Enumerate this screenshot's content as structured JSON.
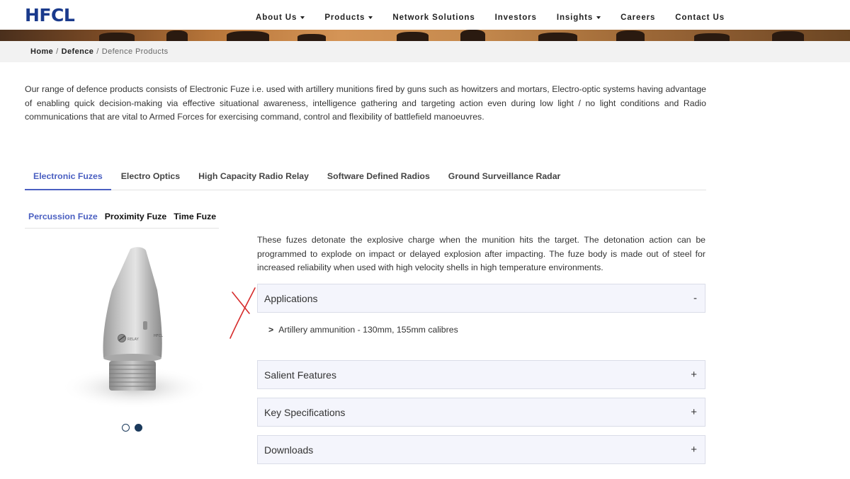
{
  "header": {
    "logo": "HFCL",
    "nav": [
      {
        "label": "About Us",
        "dropdown": true
      },
      {
        "label": "Products",
        "dropdown": true
      },
      {
        "label": "Network Solutions",
        "dropdown": false
      },
      {
        "label": "Investors",
        "dropdown": false
      },
      {
        "label": "Insights",
        "dropdown": true
      },
      {
        "label": "Careers",
        "dropdown": false
      },
      {
        "label": "Contact Us",
        "dropdown": false
      }
    ]
  },
  "breadcrumb": {
    "home": "Home",
    "sep": "/",
    "defence": "Defence",
    "current": "Defence Products"
  },
  "intro": "Our range of defence products consists of Electronic Fuze i.e. used with artillery munitions fired by guns such as howitzers and mortars, Electro-optic systems having advantage of enabling quick decision-making via effective situational awareness, intelligence gathering and targeting action even during low light / no light conditions and Radio communications that are vital to Armed Forces for exercising command, control and flexibility of battlefield manoeuvres.",
  "tabs": [
    "Electronic Fuzes",
    "Electro Optics",
    "High Capacity Radio Relay",
    "Software Defined Radios",
    "Ground Surveillance Radar"
  ],
  "subtabs": [
    "Percussion Fuze",
    "Proximity Fuze",
    "Time Fuze"
  ],
  "product": {
    "description": "These fuzes detonate the explosive charge when the munition hits the target. The detonation action can be programmed to explode on impact or delayed explosion after impacting. The fuze body is made out of steel for increased reliability when used with high velocity shells in high temperature environments.",
    "engraving_1": "RELAY",
    "engraving_2": "HFCL"
  },
  "accordion": {
    "applications": {
      "title": "Applications",
      "sign": "-",
      "item_marker": ">",
      "item": "Artillery ammunition - 130mm, 155mm calibres"
    },
    "salient": {
      "title": "Salient Features",
      "sign": "+"
    },
    "specs": {
      "title": "Key Specifications",
      "sign": "+"
    },
    "downloads": {
      "title": "Downloads",
      "sign": "+"
    }
  },
  "colors": {
    "brand": "#1a3a8c",
    "accent": "#4a5fc1",
    "dot": "#1b3a5c",
    "annotation": "#d62b2b"
  }
}
